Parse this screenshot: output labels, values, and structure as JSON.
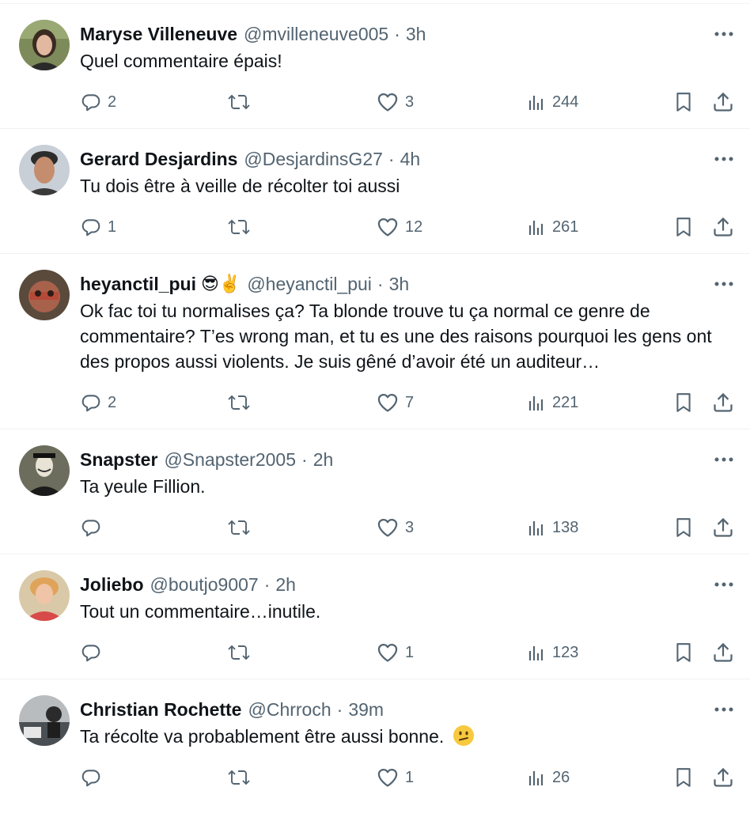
{
  "tweets": [
    {
      "name": "Maryse Villeneuve",
      "badge": "",
      "handle": "@mvilleneuve005",
      "time": "3h",
      "text": "Quel commentaire épais!",
      "replies": "2",
      "retweets": "",
      "likes": "3",
      "views": "244"
    },
    {
      "name": "Gerard Desjardins",
      "badge": "",
      "handle": "@DesjardinsG27",
      "time": "4h",
      "text": "Tu dois être à veille de récolter toi aussi",
      "replies": "1",
      "retweets": "",
      "likes": "12",
      "views": "261"
    },
    {
      "name": "heyanctil_pui",
      "badge": "😎✌️",
      "handle": "@heyanctil_pui",
      "time": "3h",
      "text": "Ok fac toi tu normalises ça? Ta blonde trouve tu ça normal ce genre de commentaire? T’es wrong man, et tu es une des raisons pourquoi les gens ont des propos aussi violents. Je suis gêné d’avoir été un auditeur…",
      "replies": "2",
      "retweets": "",
      "likes": "7",
      "views": "221"
    },
    {
      "name": "Snapster",
      "badge": "",
      "handle": "@Snapster2005",
      "time": "2h",
      "text": "Ta yeule Fillion.",
      "replies": "",
      "retweets": "",
      "likes": "3",
      "views": "138"
    },
    {
      "name": "Joliebo",
      "badge": "",
      "handle": "@boutjo9007",
      "time": "2h",
      "text": "Tout un commentaire…inutile.",
      "replies": "",
      "retweets": "",
      "likes": "1",
      "views": "123"
    },
    {
      "name": "Christian Rochette",
      "badge": "",
      "handle": "@Chrroch",
      "time": "39m",
      "text": "Ta récolte va probablement être aussi bonne.",
      "text_emoji": "🫤",
      "replies": "",
      "retweets": "",
      "likes": "1",
      "views": "26"
    }
  ],
  "separator": "·",
  "colors": {
    "text": "#0f1419",
    "secondary": "#536471",
    "divider": "#eff3f4"
  }
}
